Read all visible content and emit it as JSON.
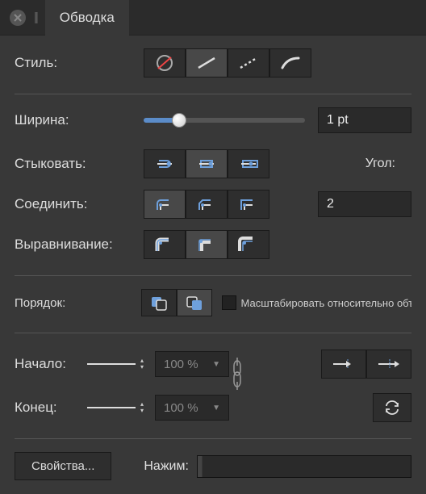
{
  "tab_title": "Обводка",
  "labels": {
    "style": "Стиль:",
    "width": "Ширина:",
    "cap": "Стыковать:",
    "join": "Соединить:",
    "align": "Выравнивание:",
    "angle": "Угол:",
    "order": "Порядок:",
    "scale": "Масштабировать относительно объ",
    "start": "Начало:",
    "end": "Конец:",
    "properties": "Свойства...",
    "pressure": "Нажим:"
  },
  "values": {
    "width": "1 pt",
    "miter": "2",
    "start_pct": "100 %",
    "end_pct": "100 %"
  },
  "style_options": [
    "none",
    "solid",
    "dashed",
    "brush"
  ],
  "style_selected": 1,
  "cap_selected": 1,
  "join_selected": 0,
  "align_selected": 1,
  "order_selected": 1,
  "colors": {
    "accent": "#5b8cc9",
    "bg": "#383838"
  }
}
